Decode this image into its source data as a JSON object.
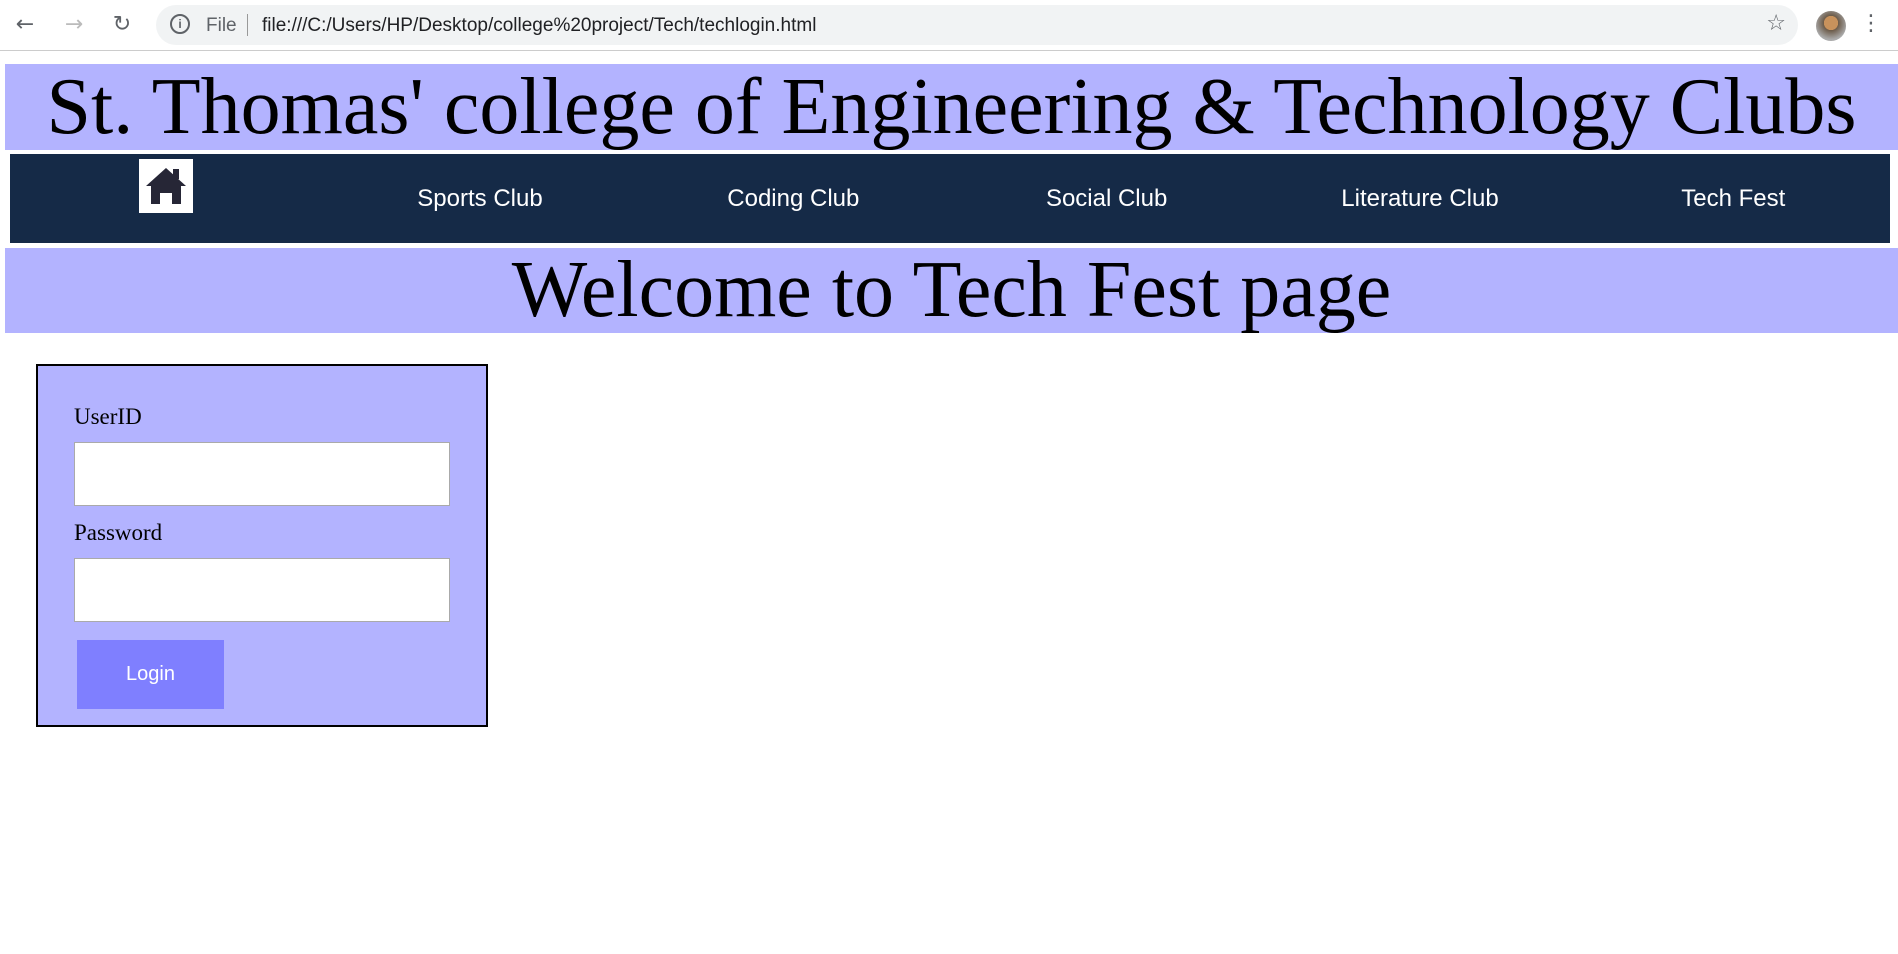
{
  "browser": {
    "url": "file:///C:/Users/HP/Desktop/college%20project/Tech/techlogin.html",
    "scheme_label": "File"
  },
  "header": {
    "title": "St. Thomas' college of Engineering & Technology Clubs"
  },
  "nav": {
    "items": [
      "Sports Club",
      "Coding Club",
      "Social Club",
      "Literature Club",
      "Tech Fest"
    ]
  },
  "page": {
    "heading": "Welcome to Tech Fest page"
  },
  "login": {
    "userid_label": "UserID",
    "userid_value": "",
    "password_label": "Password",
    "password_value": "",
    "button": "Login"
  },
  "colors": {
    "banner": "#b3b3ff",
    "nav": "#152a47",
    "button": "#7f7fff"
  }
}
